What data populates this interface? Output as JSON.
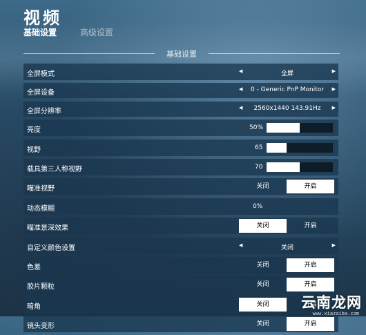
{
  "page": {
    "title": "视频",
    "tabs": [
      {
        "label": "基础设置",
        "active": true
      },
      {
        "label": "高级设置",
        "active": false
      }
    ],
    "section_header": "基础设置"
  },
  "settings": [
    {
      "type": "selector",
      "label": "全屏模式",
      "value": "全屏"
    },
    {
      "type": "selector",
      "label": "全屏设备",
      "value": "0 - Generic PnP Monitor"
    },
    {
      "type": "selector",
      "label": "全屏分辨率",
      "value": "2560x1440 143.91Hz"
    },
    {
      "type": "slider",
      "label": "亮度",
      "value": "50%",
      "fill_fraction": 0.5
    },
    {
      "type": "slider",
      "label": "视野",
      "value": "65",
      "fill_fraction": 0.3
    },
    {
      "type": "slider",
      "label": "载具第三人称视野",
      "value": "70",
      "fill_fraction": 0.5
    },
    {
      "type": "toggle",
      "label": "瞄准视野",
      "off_label": "关闭",
      "on_label": "开启",
      "selected": "on"
    },
    {
      "type": "value",
      "label": "动态模糊",
      "value": "0%"
    },
    {
      "type": "toggle",
      "label": "瞄准景深效果",
      "off_label": "关闭",
      "on_label": "开启",
      "selected": "off"
    },
    {
      "type": "selector",
      "label": "自定义颜色设置",
      "value": "关闭"
    },
    {
      "type": "toggle",
      "label": "色差",
      "off_label": "关闭",
      "on_label": "开启",
      "selected": "on"
    },
    {
      "type": "toggle",
      "label": "胶片颗粒",
      "off_label": "关闭",
      "on_label": "开启",
      "selected": "on"
    },
    {
      "type": "toggle",
      "label": "暗角",
      "off_label": "关闭",
      "on_label": "开启",
      "selected": "off"
    },
    {
      "type": "toggle",
      "label": "镜头变形",
      "off_label": "关闭",
      "on_label": "开启",
      "selected": "on"
    }
  ],
  "arrows": {
    "left": "◀",
    "right": "▶"
  },
  "watermark": {
    "text": "云南龙网",
    "url": "www.xiazaiba.com"
  }
}
